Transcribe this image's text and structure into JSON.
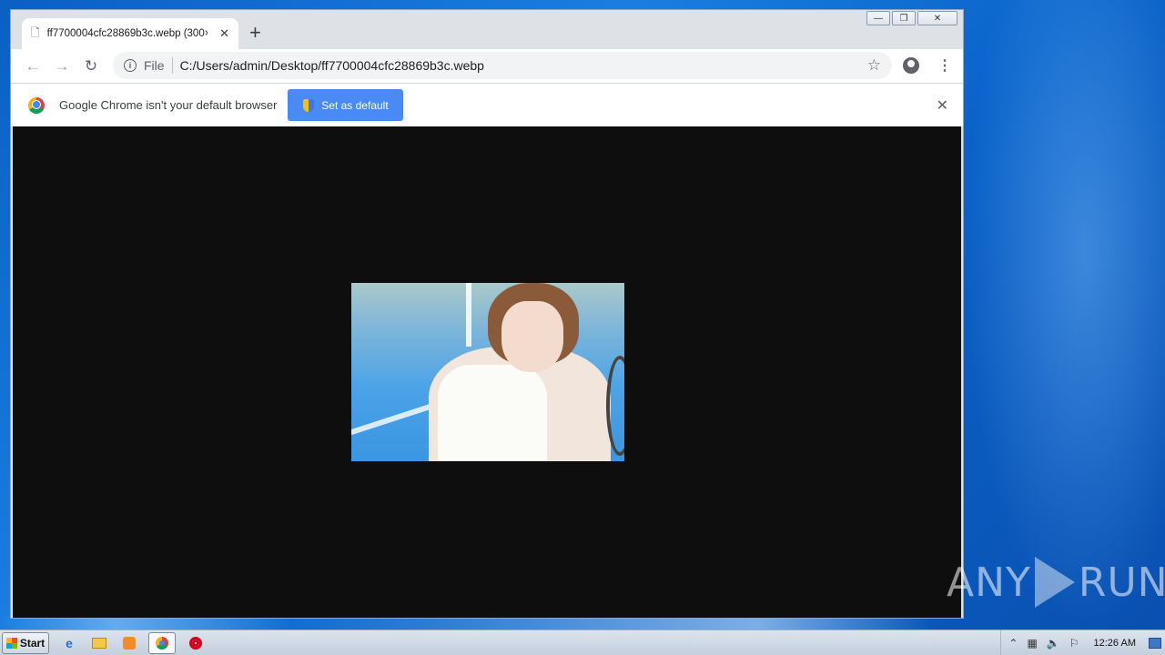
{
  "browser": {
    "tab": {
      "title": "ff7700004cfc28869b3c.webp (300×",
      "close": "✕"
    },
    "new_tab": "+",
    "toolbar": {
      "back": "←",
      "forward": "→",
      "reload": "↻",
      "scheme": "File",
      "url": "C:/Users/admin/Desktop/ff7700004cfc28869b3c.webp",
      "bookmark": "☆",
      "menu": "⋮"
    },
    "infobar": {
      "message": "Google Chrome isn't your default browser",
      "button": "Set as default",
      "close": "✕"
    },
    "window_controls": {
      "minimize": "—",
      "restore": "❐",
      "close": "✕"
    }
  },
  "watermark": {
    "left": "ANY",
    "right": "RUN"
  },
  "taskbar": {
    "start": "Start",
    "clock": "12:26 AM",
    "tray_icons": [
      "up-arrow-icon",
      "network-icon",
      "volume-icon",
      "flag-icon"
    ]
  },
  "colors": {
    "accent": "#4a8af4",
    "viewer_bg": "#0e0e0e",
    "desktop": "#1a7ee0"
  }
}
